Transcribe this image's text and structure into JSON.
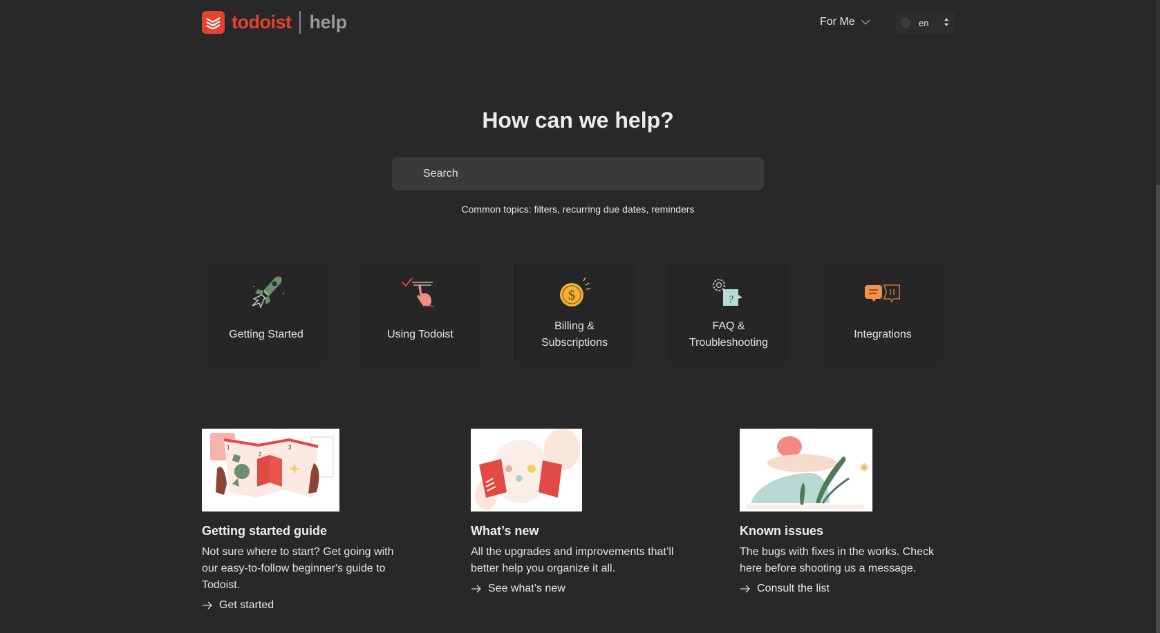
{
  "header": {
    "logo_word": "todoist",
    "logo_suffix": "help",
    "audience_menu": "For Me",
    "language": "en"
  },
  "hero": {
    "title": "How can we help?",
    "search_placeholder": "Search",
    "common_topics_label": "Common topics:",
    "common_topics": [
      "filters",
      "recurring due dates",
      "reminders"
    ]
  },
  "categories": [
    {
      "label": "Getting Started",
      "icon": "rocket-icon"
    },
    {
      "label": "Using Todoist",
      "icon": "checklist-hand-icon"
    },
    {
      "label_line1": "Billing &",
      "label_line2": "Subscriptions",
      "icon": "dollar-coin-icon"
    },
    {
      "label_line1": "FAQ &",
      "label_line2": "Troubleshooting",
      "icon": "gear-question-icon"
    },
    {
      "label": "Integrations",
      "icon": "integrations-icon"
    }
  ],
  "features": [
    {
      "title": "Getting started guide",
      "description": "Not sure where to start? Get going with our easy-to-follow beginner's guide to Todoist.",
      "cta": "Get started",
      "illustration": "fold-out-guide-illustration"
    },
    {
      "title": "What’s new",
      "description": "All the upgrades and improvements that’ll better help you organize it all.",
      "cta": "See what’s new",
      "illustration": "gift-box-illustration"
    },
    {
      "title": "Known issues",
      "description": "The bugs with fixes in the works. Check here before shooting us a message.",
      "cta": "Consult the list",
      "illustration": "stacked-stones-illustration"
    }
  ],
  "colors": {
    "brand": "#e44232",
    "background": "#282828",
    "card": "#262626",
    "search_bg": "#3a3a3a"
  }
}
